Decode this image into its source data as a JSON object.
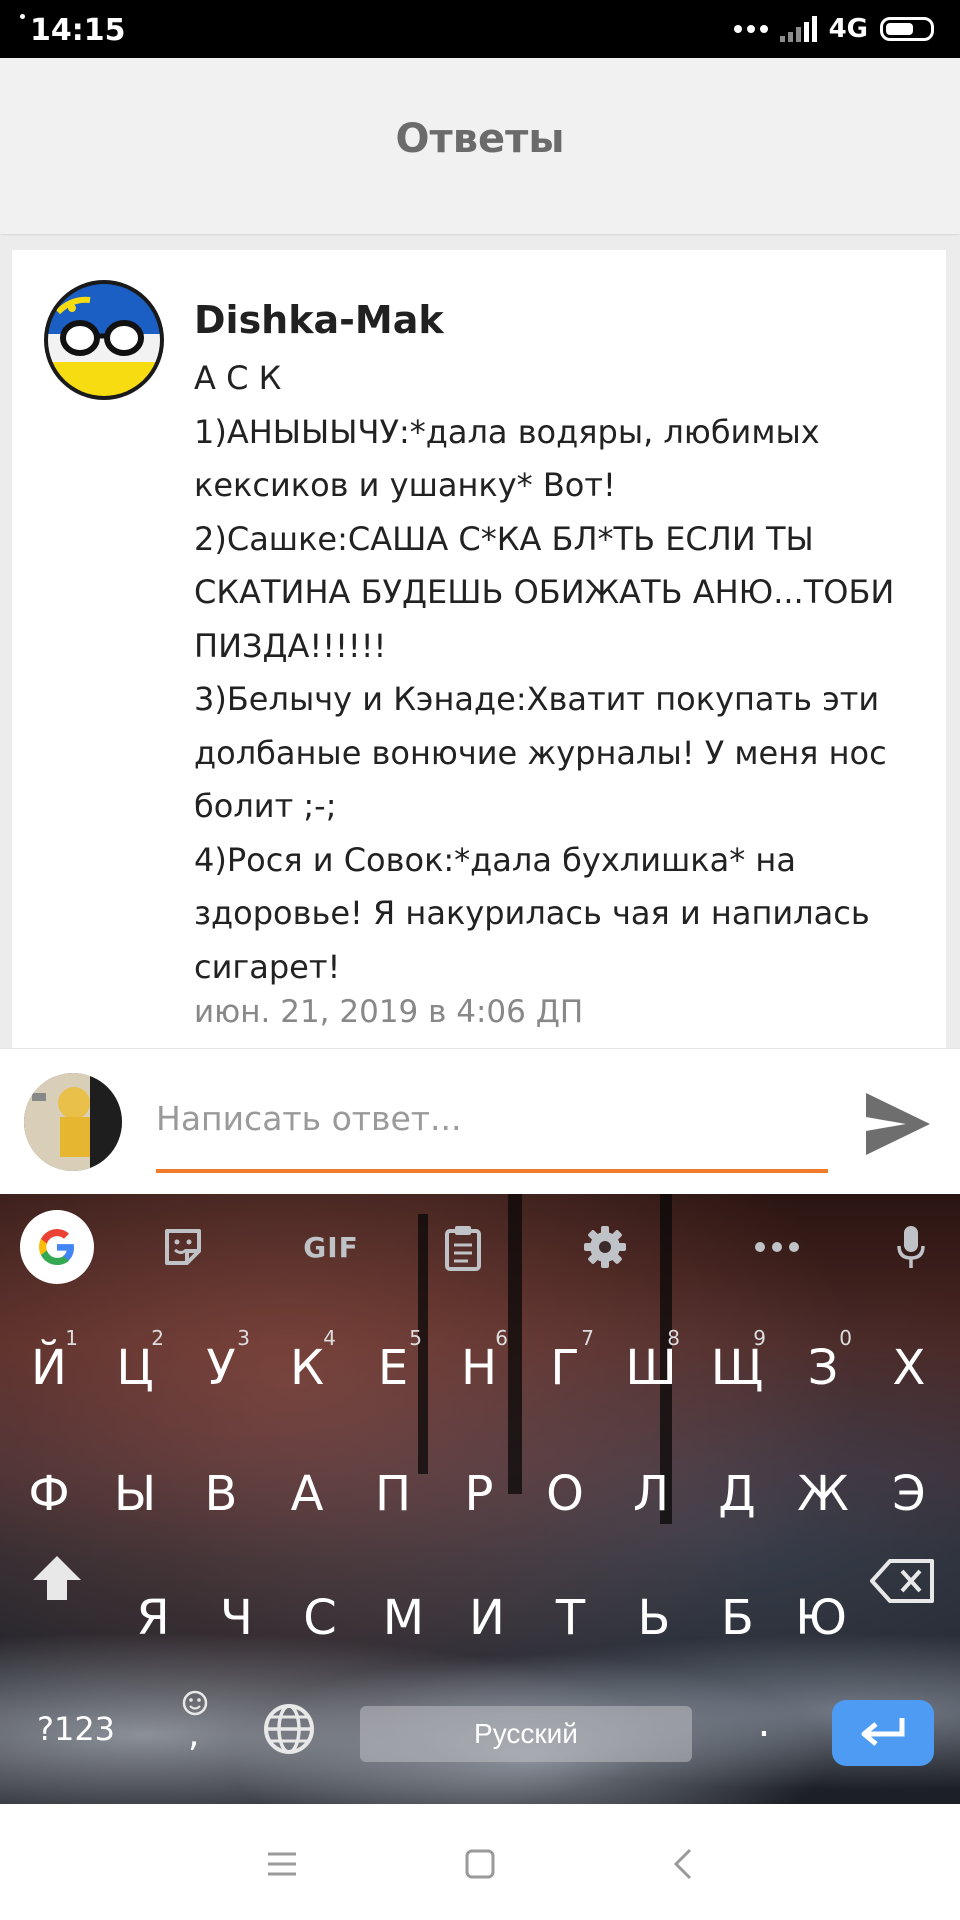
{
  "status_bar": {
    "time": "14:15",
    "network": "4G"
  },
  "header": {
    "title": "Ответы"
  },
  "post": {
    "author": "Dishka-Mak",
    "lines": [
      "А С К",
      "1)АНЫЫЫЧУ:*дала водяры, любимых кексиков и ушанку* Вот!",
      "2)Сашке:САША С*КА БЛ*ТЬ ЕСЛИ ТЫ СКАТИНА БУДЕШЬ ОБИЖАТЬ АНЮ...ТОБИ ПИЗДА!!!!!!",
      "3)Белычу и Кэнаде:Хватит покупать эти долбаные вонючие журналы! У меня нос болит ;-;",
      "4)Рося и Совок:*дала бухлишка* на здоровье! Я накурилась чая и напилась сигарет!"
    ],
    "date": "июн. 21, 2019 в 4:06 ДП"
  },
  "reply": {
    "placeholder": "Написать ответ...",
    "value": ""
  },
  "keyboard": {
    "toolbar": {
      "gif_label": "GIF"
    },
    "row1": [
      {
        "label": "Й",
        "hint": "1"
      },
      {
        "label": "Ц",
        "hint": "2"
      },
      {
        "label": "У",
        "hint": "3"
      },
      {
        "label": "К",
        "hint": "4"
      },
      {
        "label": "Е",
        "hint": "5"
      },
      {
        "label": "Н",
        "hint": "6"
      },
      {
        "label": "Г",
        "hint": "7"
      },
      {
        "label": "Ш",
        "hint": "8"
      },
      {
        "label": "Щ",
        "hint": "9"
      },
      {
        "label": "З",
        "hint": "0"
      },
      {
        "label": "Х",
        "hint": ""
      }
    ],
    "row2": [
      "Ф",
      "Ы",
      "В",
      "А",
      "П",
      "Р",
      "О",
      "Л",
      "Д",
      "Ж",
      "Э"
    ],
    "row3": [
      "Я",
      "Ч",
      "С",
      "М",
      "И",
      "Т",
      "Ь",
      "Б",
      "Ю"
    ],
    "symbols_label": "?123",
    "comma_label": ",",
    "space_label": "Русский",
    "period_label": "."
  }
}
